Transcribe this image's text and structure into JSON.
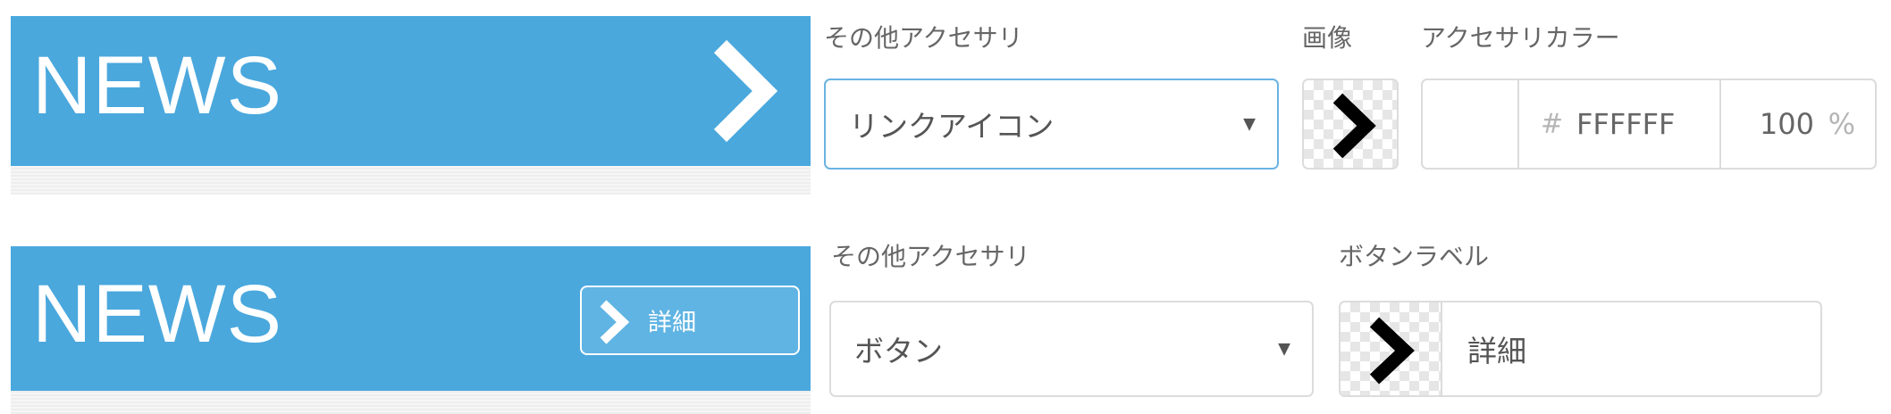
{
  "row1": {
    "banner": {
      "title": "NEWS"
    },
    "fields": {
      "accessory_label": "その他アクセサリ",
      "accessory_value": "リンクアイコン",
      "image_label": "画像",
      "color_label": "アクセサリカラー",
      "color_hash": "#",
      "color_hex": "FFFFFF",
      "opacity_value": "100",
      "opacity_unit": "%"
    }
  },
  "row2": {
    "banner": {
      "title": "NEWS",
      "button_label": "詳細"
    },
    "fields": {
      "accessory_label": "その他アクセサリ",
      "accessory_value": "ボタン",
      "button_label_title": "ボタンラベル",
      "button_label_value": "詳細"
    }
  },
  "icons": {
    "caret": "▼",
    "chevron": "chevron-right-icon"
  },
  "colors": {
    "banner_blue": "#4aa8dd",
    "focus_border": "#6ab3e2"
  }
}
